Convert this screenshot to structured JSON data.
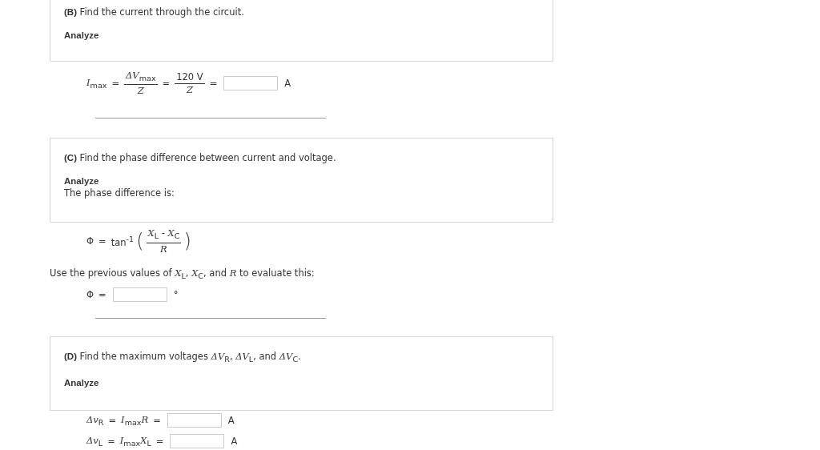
{
  "sections": [
    {
      "panel": {
        "title": "**(B)** Find the current through the circuit.",
        "heading": "Analyze"
      },
      "divider": true,
      "steps": [
        {
          "kind": "equation",
          "parts": [
            {
              "kind": "text",
              "text": "*I*$_{max}$"
            },
            {
              "kind": "text",
              "text": "="
            },
            {
              "kind": "fraction",
              "numerator": "*ΔV*$_{max}$",
              "denominator": "*Z*"
            },
            {
              "kind": "text",
              "text": "="
            },
            {
              "kind": "fraction",
              "numerator": "120 V",
              "denominator": "*Z*"
            },
            {
              "kind": "text",
              "text": "="
            },
            {
              "kind": "field"
            },
            {
              "kind": "text",
              "text": "A"
            }
          ]
        }
      ]
    },
    {
      "panel": {
        "title": "**(C)** Find the phase difference between current and voltage.",
        "heading": "Analyze",
        "text": "The phase difference is:"
      },
      "divider": true,
      "steps": [
        {
          "kind": "equation",
          "parts": [
            {
              "kind": "text",
              "text": "Φ"
            },
            {
              "kind": "text",
              "text": "="
            },
            {
              "kind": "text",
              "text": "tan$^{-1}$"
            },
            {
              "kind": "paren",
              "text": "("
            },
            {
              "kind": "fraction",
              "numerator": "*X*$_{L}$ - *X*$_{C}$",
              "denominator": "*R*"
            },
            {
              "kind": "paren",
              "text": ")"
            }
          ]
        },
        {
          "kind": "sentence",
          "text": "Use the previous values of *X*$_{L}$, *X*$_{C}$, and *R* to evaluate this:"
        },
        {
          "kind": "equation",
          "parts": [
            {
              "kind": "text",
              "text": "Φ"
            },
            {
              "kind": "text",
              "text": "="
            },
            {
              "kind": "field"
            },
            {
              "kind": "text",
              "text": "°"
            }
          ]
        }
      ]
    },
    {
      "panel": {
        "title": "**(D)** Find the maximum voltages *ΔV*$_{R}$, *ΔV*$_{L}$, and *ΔV*$_{C}$.",
        "heading": "Analyze"
      },
      "divider": false,
      "steps": [
        {
          "kind": "equation",
          "parts": [
            {
              "kind": "text",
              "text": "*Δv*$_{R}$"
            },
            {
              "kind": "text",
              "text": "="
            },
            {
              "kind": "text",
              "text": "*I*$_{max}$*R*"
            },
            {
              "kind": "text",
              "text": "="
            },
            {
              "kind": "field"
            },
            {
              "kind": "text",
              "text": "A"
            }
          ]
        },
        {
          "kind": "equation",
          "parts": [
            {
              "kind": "text",
              "text": "*Δv*$_{L}$"
            },
            {
              "kind": "text",
              "text": "="
            },
            {
              "kind": "text",
              "text": "*I*$_{max}$*X*$_{L}$"
            },
            {
              "kind": "text",
              "text": "="
            },
            {
              "kind": "field"
            },
            {
              "kind": "text",
              "text": "A"
            }
          ]
        }
      ]
    }
  ]
}
